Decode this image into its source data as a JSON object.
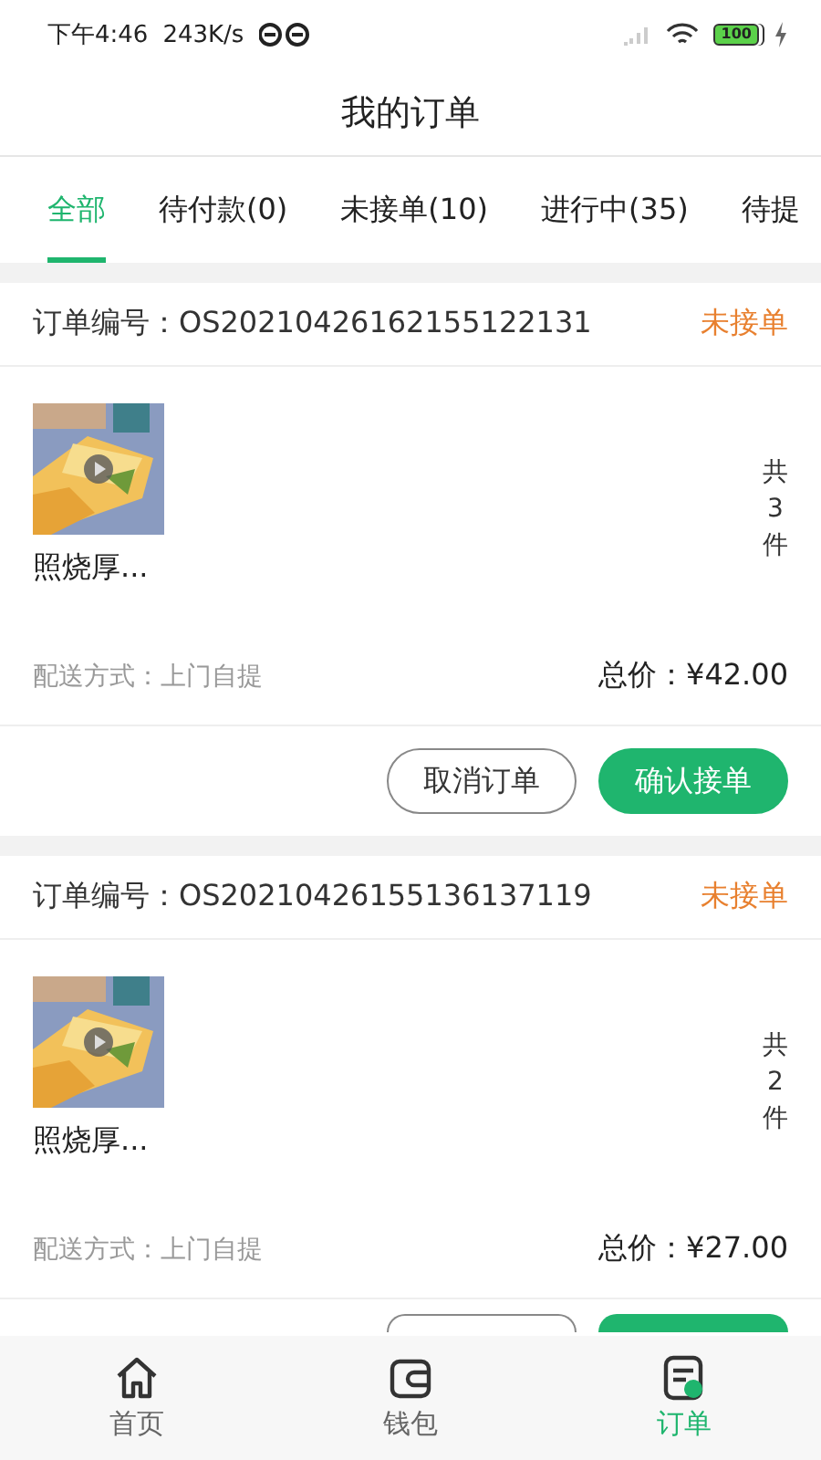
{
  "status_bar": {
    "time": "下午4:46",
    "speed": "243K/s",
    "battery": "100"
  },
  "title": "我的订单",
  "tabs": [
    {
      "label": "全部",
      "selected": true
    },
    {
      "label": "待付款(0)",
      "selected": false
    },
    {
      "label": "未接单(10)",
      "selected": false
    },
    {
      "label": "进行中(35)",
      "selected": false
    },
    {
      "label": "待提",
      "selected": false
    }
  ],
  "orders": [
    {
      "number_label": "订单编号：",
      "number": "OS20210426162155122131",
      "status": "未接单",
      "item_name": "照烧厚...",
      "count": [
        "共",
        "3",
        "件"
      ],
      "delivery": "配送方式：上门自提",
      "total": "总价：¥42.00",
      "buttons": [
        {
          "label": "取消订单",
          "kind": "outline"
        },
        {
          "label": "确认接单",
          "kind": "primary"
        }
      ]
    },
    {
      "number_label": "订单编号：",
      "number": "OS20210426155136137119",
      "status": "未接单",
      "item_name": "照烧厚...",
      "count": [
        "共",
        "2",
        "件"
      ],
      "delivery": "配送方式：上门自提",
      "total": "总价：¥27.00",
      "buttons": [
        {
          "kind": "outline"
        },
        {
          "kind": "primary"
        }
      ]
    }
  ],
  "nav": [
    {
      "label": "首页",
      "kind": "home",
      "selected": false
    },
    {
      "label": "钱包",
      "kind": "wallet",
      "selected": false
    },
    {
      "label": "订单",
      "kind": "order",
      "selected": true
    }
  ]
}
